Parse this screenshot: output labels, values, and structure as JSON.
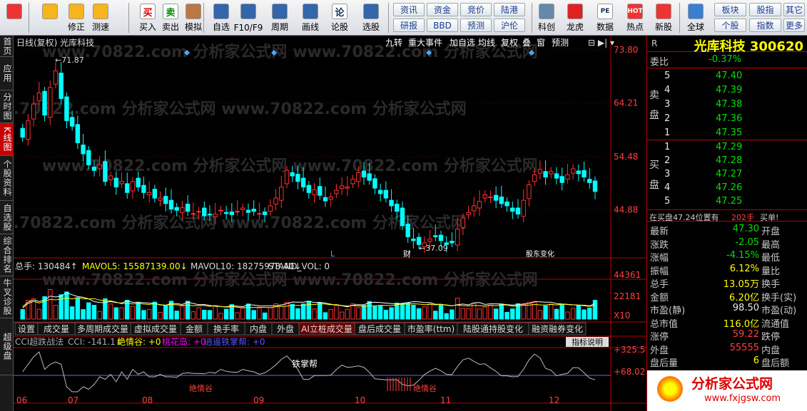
{
  "toolbar": {
    "buttons": [
      {
        "label": "",
        "icon": "grid-icon"
      },
      {
        "label": "",
        "icon": "back-arrow-icon"
      },
      {
        "label": "修正",
        "icon": "up-arrow-icon"
      },
      {
        "label": "测速",
        "icon": "clock-icon"
      },
      {
        "label": "买入",
        "icon": "buy-icon",
        "glyph": "买"
      },
      {
        "label": "卖出",
        "icon": "sell-icon",
        "glyph": "卖"
      },
      {
        "label": "模拟",
        "icon": "hammer-icon"
      },
      {
        "label": "自选",
        "icon": "star-icon"
      },
      {
        "label": "F10/F9",
        "icon": "f10-icon"
      },
      {
        "label": "周期",
        "icon": "period-icon"
      },
      {
        "label": "画线",
        "icon": "pen-icon"
      },
      {
        "label": "论股",
        "icon": "discuss-icon",
        "glyph": "论"
      },
      {
        "label": "选股",
        "icon": "magnifier-icon"
      }
    ],
    "pills_row1": [
      "资讯",
      "资金",
      "竞价",
      "陆港"
    ],
    "pills_row2": [
      "研报",
      "BBD",
      "预测",
      "沪伦"
    ],
    "buttons2": [
      {
        "label": "科创",
        "icon": "chart-icon"
      },
      {
        "label": "龙虎",
        "icon": "dragon-icon"
      },
      {
        "label": "数据",
        "icon": "pe-icon",
        "glyph": "PE"
      },
      {
        "label": "热点",
        "icon": "hot-icon",
        "glyph": "HOT"
      },
      {
        "label": "新股",
        "icon": "new-icon"
      },
      {
        "label": "全球",
        "icon": "globe-icon"
      }
    ],
    "right_pills_row1": [
      "板块",
      "股指",
      "其它"
    ],
    "right_pills_row2": [
      "个股",
      "指数",
      "更多"
    ]
  },
  "leftnav": [
    "首页",
    "应用",
    "分时图",
    "K线图",
    "个股资料",
    "自选股",
    "综合排名",
    "牛叉诊股",
    "超级盘"
  ],
  "chart": {
    "header_title": "日线(复权)  光库科技",
    "menu": [
      "九转",
      "重大事件",
      "加自选",
      "均线",
      "复权",
      "叠",
      "窗",
      "预测"
    ],
    "price_axis": [
      "73.80",
      "64.21",
      "54.48",
      "44.88"
    ],
    "high_label": "71.87",
    "low_label": "37.09",
    "markers": {
      "L": "L",
      "cai": "财",
      "tuo": "股东变化"
    },
    "vol_header": {
      "title": "总手: 130484",
      "ma5": "MAVOL5: 15587139.00",
      "ma10": "MAVOL10: 18275978.40",
      "std": "STAND_VOL: 0"
    },
    "vol_axis": [
      "44361",
      "22181",
      "X10"
    ],
    "vol_tabs": [
      "设置",
      "成交量",
      "多周期成交量",
      "虚拟成交量",
      "金额",
      "换手率",
      "内盘",
      "外盘",
      "AI立桩成交量",
      "盘后成交量",
      "市盈率(ttm)",
      "陆股通持股变化",
      "融资融券变化"
    ],
    "cci_header": {
      "name": "CCI超跌战法",
      "cci": "CCI: -141.1",
      "a": "绝情谷: +0",
      "b": "桃花岛: +0",
      "c": "逍遥铁掌帮: +0"
    },
    "cci_btn": "指标说明",
    "cci_axis": [
      "+325.5",
      "+68.02"
    ],
    "cci_labels": {
      "tie": "铁掌帮",
      "jue": "绝情谷",
      "jue2": "绝情谷"
    },
    "months": [
      "06",
      "07",
      "08",
      "09",
      "10",
      "11",
      "12"
    ],
    "watermark": "www.70822.com   分析家公式网"
  },
  "quote": {
    "title": "光库科技 300620",
    "R": "R",
    "webi_label": "委比",
    "webi": "-0.37%",
    "sell_label": "卖盘",
    "buy_label": "买盘",
    "sell": [
      {
        "n": "5",
        "p": "47.40"
      },
      {
        "n": "4",
        "p": "47.39"
      },
      {
        "n": "3",
        "p": "47.38"
      },
      {
        "n": "2",
        "p": "47.36"
      },
      {
        "n": "1",
        "p": "47.35"
      }
    ],
    "buy": [
      {
        "n": "1",
        "p": "47.29"
      },
      {
        "n": "2",
        "p": "47.28"
      },
      {
        "n": "3",
        "p": "47.27"
      },
      {
        "n": "4",
        "p": "47.26"
      },
      {
        "n": "5",
        "p": "47.25"
      }
    ],
    "notice": {
      "pre": "在买盘47.24位置有",
      "qty": "202手",
      "post": "买单!"
    },
    "stats": [
      {
        "l": "最新",
        "v": "47.30",
        "c": "green",
        "r": "开盘"
      },
      {
        "l": "涨跌",
        "v": "-2.05",
        "c": "green",
        "r": "最高"
      },
      {
        "l": "涨幅",
        "v": "-4.15%",
        "c": "green",
        "r": "最低"
      },
      {
        "l": "振幅",
        "v": "6.12%",
        "c": "yellow",
        "r": "量比"
      },
      {
        "l": "总手",
        "v": "13.05万",
        "c": "yellow",
        "r": "换手"
      },
      {
        "l": "金额",
        "v": "6.20亿",
        "c": "yellow",
        "r": "换手(实)"
      },
      {
        "l": "市盈(静)",
        "v": "98.50",
        "c": "white",
        "r": "市盈(动)"
      },
      {
        "l": "总市值",
        "v": "116.0亿",
        "c": "yellow",
        "r": "流通值"
      },
      {
        "l": "涨停",
        "v": "59.22",
        "c": "red",
        "r": "跌停"
      },
      {
        "l": "外盘",
        "v": "55555",
        "c": "red",
        "r": "内盘"
      },
      {
        "l": "盘后量",
        "v": "6",
        "c": "yellow",
        "r": "盘后额"
      }
    ],
    "logo_text": "分析家公式网",
    "logo_url": "www.fxjgsw.com"
  },
  "colors": {
    "up": "#ff3030",
    "down": "#00ffff",
    "bg": "#000000",
    "ma5": "#ffffff",
    "ma10": "#ffff00"
  },
  "chart_data": {
    "type": "candlestick",
    "ylim": [
      37.09,
      73.8
    ],
    "close": [
      58,
      61,
      64,
      66,
      62,
      67,
      70,
      65,
      61,
      60,
      57,
      55,
      53,
      52,
      53,
      50,
      51,
      49,
      50,
      48,
      50,
      49,
      48,
      48,
      47,
      47,
      46,
      45,
      44.8,
      45.3,
      44.6,
      44.2,
      44.6,
      43.8,
      44.0,
      44.1,
      44.8,
      44.2,
      44.0,
      44.6,
      45.2,
      44.4,
      44.6,
      44.2,
      44.0,
      45.6,
      47,
      49,
      52,
      51,
      50,
      49,
      48,
      48.5,
      47.5,
      46.5,
      47.2,
      48.4,
      49.2,
      49,
      50.4,
      51.6,
      50.8,
      50.2,
      48.8,
      47.8,
      47,
      45.6,
      44.6,
      42,
      40,
      39.3,
      38.6,
      38.9,
      39.6,
      40,
      39.3,
      38.6,
      38.9,
      41.4,
      43.4,
      44.4,
      45.6,
      46.4,
      47.6,
      47.2,
      46.6,
      46,
      45.6,
      44.6,
      44.1,
      46.6,
      49.4,
      51.2,
      52.2,
      50.8,
      51.8,
      50.6,
      49.8,
      51.2,
      52.3,
      51.4,
      50.8,
      49.8,
      48.2
    ]
  }
}
